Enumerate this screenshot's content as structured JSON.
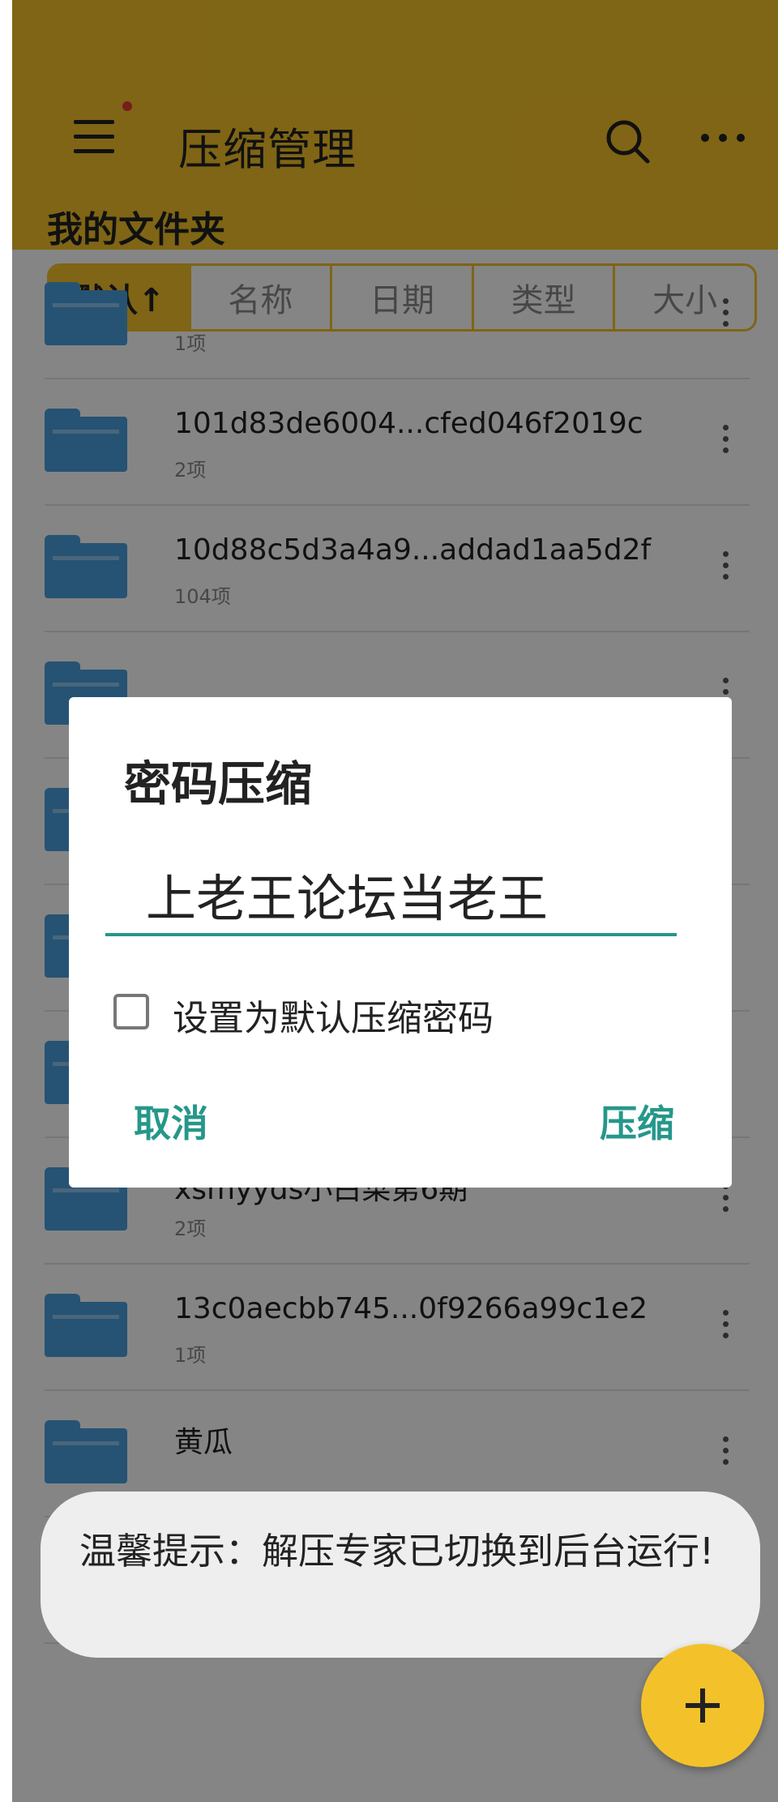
{
  "app_bar": {
    "title": "压缩管理",
    "folder_label": "我的文件夹",
    "icons": [
      "menu-icon",
      "search-icon",
      "more-icon"
    ]
  },
  "sort_tabs": [
    {
      "label": "默认↑",
      "active": true
    },
    {
      "label": "名称",
      "active": false
    },
    {
      "label": "日期",
      "active": false
    },
    {
      "label": "类型",
      "active": false
    },
    {
      "label": "大小",
      "active": false
    }
  ],
  "files": [
    {
      "name": "",
      "count": "1项"
    },
    {
      "name": "101d83de6004...cfed046f2019c",
      "count": "2项"
    },
    {
      "name": "10d88c5d3a4a9...addad1aa5d2f",
      "count": "104项"
    },
    {
      "name": "",
      "count": ""
    },
    {
      "name": "",
      "count": ""
    },
    {
      "name": "",
      "count": ""
    },
    {
      "name": "",
      "count": ""
    },
    {
      "name": "xsmyyds小白菜第6期",
      "count": "2项"
    },
    {
      "name": "13c0aecbb745...0f9266a99c1e2",
      "count": "1项"
    },
    {
      "name": "黄瓜",
      "count": ""
    }
  ],
  "dialog": {
    "title": "密码压缩",
    "password_value": "上老王论坛当老王",
    "checkbox_label": "设置为默认压缩密码",
    "checkbox_checked": false,
    "cancel_label": "取消",
    "confirm_label": "压缩"
  },
  "toast": {
    "text": "温馨提示：解压专家已切换到后台运行!"
  },
  "fab": {
    "icon": "plus-icon"
  },
  "colors": {
    "accent_yellow": "#f3c22a",
    "dialog_teal": "#26978a",
    "folder_blue": "#4a9fdd"
  }
}
